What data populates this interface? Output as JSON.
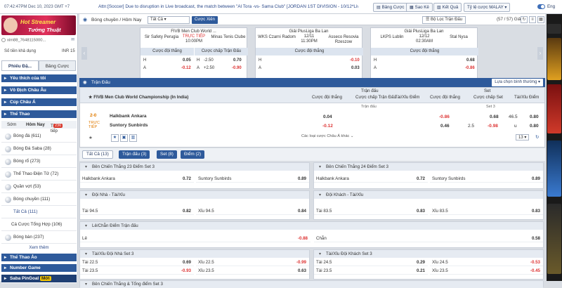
{
  "topbar": {
    "time": "07:42:47PM Dec 10, 2023 GMT +7",
    "ticker": "Attn:[Soccer] Due to disruption in Live broadcast, the match between \"Al Tora -vs- Sama Club\" [JORDAN 1ST DIVISION - 10/12*Live*] this",
    "buttons": [
      "Bảng Cược",
      "Sao Kê",
      "Kết Quả",
      "Tỷ lệ cược MALAY"
    ],
    "lang": "Eng"
  },
  "sidebar": {
    "banner_line1": "Hot Streamer",
    "banner_line2": "Tướng Thuật",
    "account": "xim88_7648115000...",
    "balance_label": "Số tiền khả dụng",
    "balance_value": "INR 15",
    "tab_active": "Phiếu Đặ...",
    "tab_other": "Bảng Cược",
    "sections": [
      "Yêu thích của tôi",
      "Vô Địch Châu Âu",
      "Cúp Châu Á",
      "Thể Thao"
    ],
    "subtabs": [
      "Sớm",
      "Hôm Nay",
      "Trực tiếp"
    ],
    "live_badge": "236",
    "sports": [
      {
        "label": "Bóng đá (611)"
      },
      {
        "label": "Bóng Đá Saba (28)"
      },
      {
        "label": "Bóng rổ (273)"
      },
      {
        "label": "Thể Thao Điện Tử (72)"
      },
      {
        "label": "Quần vợt (53)"
      },
      {
        "label": "Bóng chuyền (111)"
      }
    ],
    "sub_items": [
      "Tất Cả (111)",
      "Cá Cược Tổng Hợp (106)"
    ],
    "sport_after": "Bóng bàn (237)",
    "see_more": "Xem thêm",
    "bottom_sections": [
      "Thể Thao Ảo",
      "Number Game",
      "Saba PinGoal"
    ],
    "pingoal_badge": "Mới"
  },
  "main": {
    "title": "Bóng chuyền / Hôm Nay",
    "select": "Tất Cả",
    "select_btn": "Cược Xiên",
    "filter": "Bộ Lọc Trận Đấu",
    "count": "(57 / 57) Giải",
    "cards": [
      {
        "league": "FIVB Men Club World ...",
        "home": "Sir Safety Perugia",
        "away": "Minas Tenis Clube",
        "status": "TRỰC TIẾP",
        "time": "10:00PM",
        "h1": "Cược đội thắng",
        "h2": "Cược chấp Trận Đấu",
        "r1": [
          "H",
          "0.05",
          "H",
          "-2.50",
          "0.70"
        ],
        "r2": [
          "A",
          "-0.12",
          "A",
          "+2.50",
          "-0.90"
        ]
      },
      {
        "league": "Giải PlusLiga Ba Lan",
        "home": "WKS Czarni Radom",
        "away": "Asseco Resovia Rzeszow",
        "status": "12/11",
        "time": "11:30PM",
        "h1": "Cược đội thắng",
        "r1": [
          "H",
          "-0.10"
        ],
        "r2": [
          "A",
          "0.03"
        ]
      },
      {
        "league": "Giải PlusLiga Ba Lan",
        "home": "LKPS Lublin",
        "away": "Stal Nysa",
        "status": "12/12",
        "time": "02:30AM",
        "h1": "Cược đội thắng",
        "r1": [
          "H",
          "0.68"
        ],
        "r2": [
          "A",
          "-0.86"
        ]
      }
    ],
    "section_title": "Trận Đấu",
    "section_btn": "Lựa chọn bình thường",
    "table": {
      "group_match": "Trận đấu",
      "group_set": "Set",
      "cols": [
        "Cược đội thắng",
        "Cược chấp Trận Đấu",
        "Tài/Xỉu Điểm",
        "Cược đội thắng",
        "Cược chấp Set",
        "Tài/Xỉu Điểm"
      ],
      "sub_match": "Trận đấu",
      "sub_set": "Set 3",
      "league": "FIVB Men Club World Championship (In India)",
      "score": "2-0",
      "live": "TRỰC TIẾP",
      "home": "Halkbank Ankara",
      "away": "Suntory Sunbirds",
      "home_ml": "0.04",
      "away_ml": "-0.12",
      "set_home_ml": "-0.86",
      "set_away_ml": "0.46",
      "set_hcap_home": "0.68",
      "set_hcap_line": "2.5",
      "set_hcap_away": "-0.98",
      "set_ou_line": "46.5",
      "set_ou_over": "0.80",
      "set_ou_u": "u",
      "set_ou_under": "0.80",
      "more": "Các loại cược Châu Á khác",
      "page": "13"
    },
    "tabs": [
      "Tất Cả (13)",
      "Trận đấu (3)",
      "Set (8)",
      "Điểm (2)"
    ],
    "panels": [
      {
        "title": "Bên Chiến Thắng 23 Điểm Set 3",
        "cells": [
          [
            "Halkbank Ankara",
            "0.72"
          ],
          [
            "Suntory Sunbirds",
            "0.89"
          ]
        ]
      },
      {
        "title": "Bên Chiến Thắng 24 Điểm Set 3",
        "cells": [
          [
            "Halkbank Ankara",
            "0.72"
          ],
          [
            "Suntory Sunbirds",
            "0.89"
          ]
        ]
      },
      {
        "title": "Đội Nhà - Tài/Xỉu",
        "cells": [
          [
            "Tài 94.5",
            "0.82"
          ],
          [
            "Xỉu 94.5",
            "0.84"
          ]
        ]
      },
      {
        "title": "Đội Khách - Tài/Xỉu",
        "cells": [
          [
            "Tài 83.5",
            "0.83"
          ],
          [
            "Xỉu 83.5",
            "0.83"
          ]
        ]
      },
      {
        "title": "Lẻ/Chẵn Điểm Trận đấu",
        "cells": [
          [
            "Lẻ",
            "-0.88"
          ],
          [
            "Chẵn",
            "0.58"
          ]
        ]
      },
      {
        "title": "Tài/Xỉu Đội Nhà Set 3",
        "cells": [
          [
            "Tài 22.5",
            "0.69"
          ],
          [
            "Xỉu 22.5",
            "-0.99"
          ],
          [
            "Tài 23.5",
            "-0.93"
          ],
          [
            "Xỉu 23.5",
            "0.63"
          ]
        ]
      },
      {
        "title": "Tài/Xỉu Đội Khách Set 3",
        "cells": [
          [
            "Tài 24.5",
            "0.29"
          ],
          [
            "Xỉu 24.5",
            "-0.53"
          ],
          [
            "Tài 23.5",
            "0.21"
          ],
          [
            "Xỉu 23.5",
            "-0.45"
          ]
        ]
      },
      {
        "title": "Bên Chiến Thắng & Tổng điểm Set 3",
        "cells": []
      }
    ]
  },
  "colors": {
    "accent": "#2e5a9b",
    "negative": "#d33333"
  }
}
